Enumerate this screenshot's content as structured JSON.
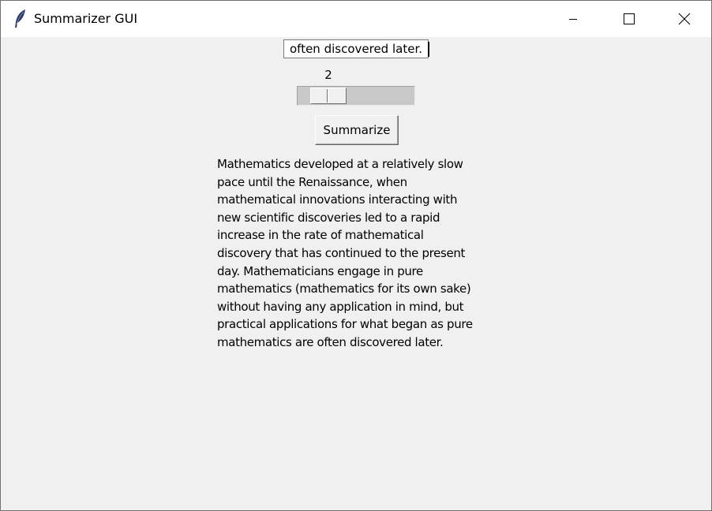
{
  "window": {
    "title": "Summarizer GUI",
    "app_icon": "feather-icon",
    "controls": {
      "minimize_icon": "minimize-icon",
      "maximize_icon": "maximize-icon",
      "close_icon": "close-icon"
    }
  },
  "form": {
    "entry_value": "often discovered later.",
    "scale_value": "2",
    "summarize_label": "Summarize"
  },
  "summary": {
    "lines": [
      "Mathematics developed at a relatively slow",
      "pace until the Renaissance, when",
      "mathematical innovations interacting with",
      "new scientific discoveries led to a rapid",
      "increase in the rate of mathematical",
      "discovery that has continued to the present",
      "day. Mathematicians engage in pure",
      "mathematics (mathematics for its own sake)",
      "without having any application in mind, but",
      "practical applications for what began as pure",
      "mathematics are often discovered later."
    ]
  },
  "colors": {
    "window_bg": "#f0f0f0",
    "titlebar_bg": "#ffffff",
    "trough": "#c8c8c8",
    "feather": "#2b3a67"
  }
}
